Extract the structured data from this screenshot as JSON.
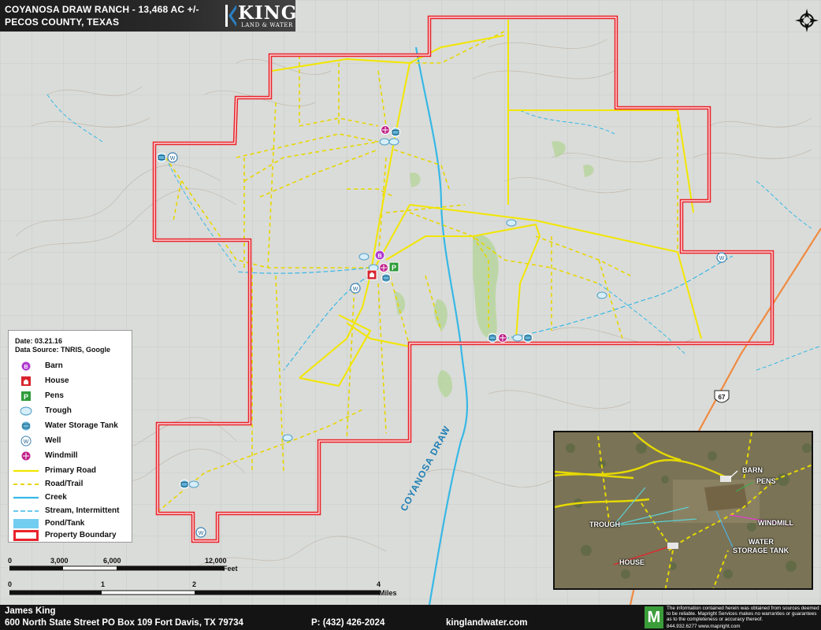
{
  "header": {
    "title_line1": "COYANOSA DRAW RANCH - 13,468 AC +/-",
    "title_line2": "PECOS COUNTY, TEXAS",
    "brand_name": "KING",
    "brand_sub": "LAND & WATER"
  },
  "map": {
    "draw_label": "COYANOSA DRAW",
    "highway_shield": "67",
    "colors": {
      "boundary": "#e8232b",
      "primary_road": "#f2e600",
      "trail": "#e7d600",
      "creek": "#37b8e6",
      "barn": "#b03bd1",
      "house": "#d8242d",
      "pens": "#2f9c3a",
      "windmill": "#c0208a",
      "tank": "#5fb2d8"
    }
  },
  "legend": {
    "date": "Date: 03.21.16",
    "source": "Data Source: TNRIS, Google",
    "items": [
      {
        "icon": "barn-icon",
        "label": "Barn"
      },
      {
        "icon": "house-icon",
        "label": "House"
      },
      {
        "icon": "pens-icon",
        "label": "Pens"
      },
      {
        "icon": "trough-icon",
        "label": "Trough"
      },
      {
        "icon": "water-storage-tank-icon",
        "label": "Water Storage Tank"
      },
      {
        "icon": "well-icon",
        "label": "Well"
      },
      {
        "icon": "windmill-icon",
        "label": "Windmill"
      },
      {
        "icon": "primary-road-line",
        "label": "Primary Road"
      },
      {
        "icon": "road-trail-line",
        "label": "Road/Trail"
      },
      {
        "icon": "creek-line",
        "label": "Creek"
      },
      {
        "icon": "stream-intermittent-line",
        "label": "Stream, Intermittent"
      },
      {
        "icon": "pond-tank-swatch",
        "label": "Pond/Tank"
      },
      {
        "icon": "property-boundary-swatch",
        "label": "Property Boundary"
      }
    ]
  },
  "scale_feet": {
    "ticks": [
      "0",
      "3,000",
      "6,000",
      "12,000"
    ],
    "unit": "Feet"
  },
  "scale_miles": {
    "ticks": [
      "0",
      "1",
      "2",
      "4"
    ],
    "unit": "Miles"
  },
  "inset": {
    "labels": [
      "BARN",
      "PENS",
      "WINDMILL",
      "TROUGH",
      "WATER",
      "STORAGE TANK",
      "HOUSE"
    ]
  },
  "footer": {
    "name": "James King",
    "address": "600 North State Street PO Box 109 Fort Davis, TX 79734",
    "phone": "P: (432) 426-2024",
    "website": "kinglandwater.com",
    "logo_letter": "M",
    "disclaimer": "The information contained herein was obtained from sources deemed to be reliable. Mapright Services makes no warranties or guarantees as to the completeness or accuracy thereof.",
    "disclaimer_contact": "844.932.6277    www.mapright.com"
  }
}
